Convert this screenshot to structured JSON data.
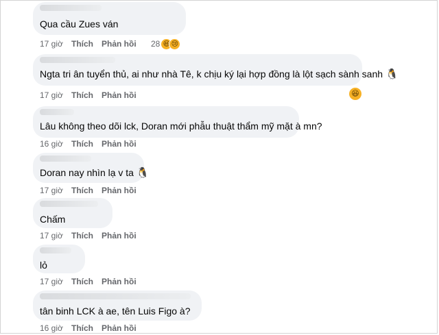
{
  "comments": [
    {
      "text": "Qua cầu Zues ván",
      "time": "17 giờ",
      "like": "Thích",
      "reply": "Phản hồi",
      "reaction_count": "28"
    },
    {
      "text": "Ngta tri ân tuyển thủ, ai như nhà Tê, k chịu ký lại hợp đồng là lột sạch sành sanh",
      "emoji": "🐧",
      "time": "17 giờ",
      "like": "Thích",
      "reply": "Phản hồi"
    },
    {
      "text": "Lâu không theo dõi lck, Doran mới phẫu thuật thẩm mỹ mặt à mn?",
      "time": "16 giờ",
      "like": "Thích",
      "reply": "Phản hồi"
    },
    {
      "text": "Doran nay nhìn lạ v ta",
      "emoji": "🐧",
      "time": "17 giờ",
      "like": "Thích",
      "reply": "Phản hồi"
    },
    {
      "text": "Chấm",
      "time": "17 giờ",
      "like": "Thích",
      "reply": "Phản hồi"
    },
    {
      "text": "lỏ",
      "time": "17 giờ",
      "like": "Thích",
      "reply": "Phản hồi"
    },
    {
      "text": "tân binh LCK à ae, tên Luis Figo à?",
      "time": "16 giờ",
      "like": "Thích",
      "reply": "Phản hồi"
    }
  ],
  "icons": {
    "reaction_haha": "haha-icon",
    "reaction_sad": "sad-icon",
    "side_haha": "haha-icon"
  }
}
